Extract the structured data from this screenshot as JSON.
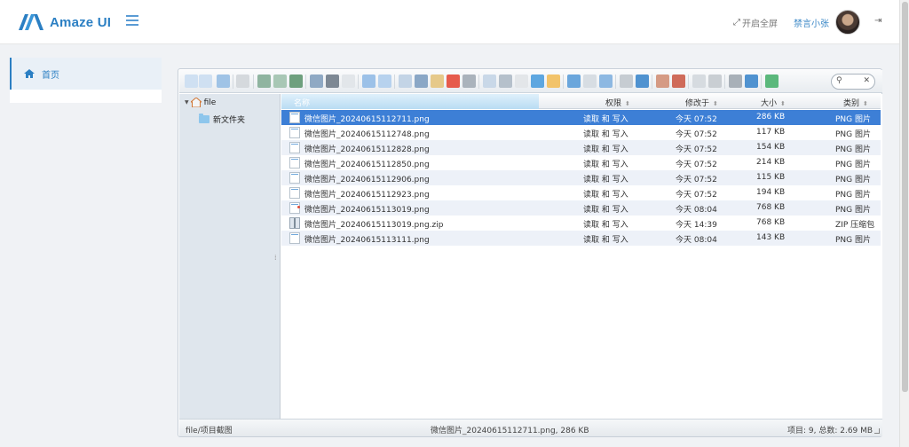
{
  "header": {
    "brand": "Amaze UI",
    "fullscreen_label": "开启全屏",
    "user_name": "禁言小张"
  },
  "sidebar": {
    "items": [
      {
        "label": "首页",
        "icon": "home-icon",
        "active": true
      }
    ]
  },
  "toolbar": {
    "search_placeholder": ""
  },
  "tree": {
    "root": "file",
    "children": [
      "新文件夹"
    ]
  },
  "columns": {
    "name": "名称",
    "perm": "权限",
    "modified": "修改于",
    "size": "大小",
    "kind": "类别"
  },
  "files": [
    {
      "name": "微信图片_20240615112711.png",
      "perm": "读取 和 写入",
      "modified": "今天 07:52",
      "size": "286 KB",
      "kind": "PNG 图片",
      "selected": true
    },
    {
      "name": "微信图片_20240615112748.png",
      "perm": "读取 和 写入",
      "modified": "今天 07:52",
      "size": "117 KB",
      "kind": "PNG 图片"
    },
    {
      "name": "微信图片_20240615112828.png",
      "perm": "读取 和 写入",
      "modified": "今天 07:52",
      "size": "154 KB",
      "kind": "PNG 图片"
    },
    {
      "name": "微信图片_20240615112850.png",
      "perm": "读取 和 写入",
      "modified": "今天 07:52",
      "size": "214 KB",
      "kind": "PNG 图片"
    },
    {
      "name": "微信图片_20240615112906.png",
      "perm": "读取 和 写入",
      "modified": "今天 07:52",
      "size": "115 KB",
      "kind": "PNG 图片"
    },
    {
      "name": "微信图片_20240615112923.png",
      "perm": "读取 和 写入",
      "modified": "今天 07:52",
      "size": "194 KB",
      "kind": "PNG 图片"
    },
    {
      "name": "微信图片_20240615113019.png",
      "perm": "读取 和 写入",
      "modified": "今天 08:04",
      "size": "768 KB",
      "kind": "PNG 图片"
    },
    {
      "name": "微信图片_20240615113019.png.zip",
      "perm": "读取 和 写入",
      "modified": "今天 14:39",
      "size": "768 KB",
      "kind": "ZIP 压缩包"
    },
    {
      "name": "微信图片_20240615113111.png",
      "perm": "读取 和 写入",
      "modified": "今天 08:04",
      "size": "143 KB",
      "kind": "PNG 图片"
    }
  ],
  "status": {
    "path": "file/项目截图",
    "selection": "微信图片_20240615112711.png, 286 KB",
    "summary": "项目: 9, 总数: 2.69 MB"
  },
  "colors": {
    "accent": "#2b7fc3",
    "selection": "#3d7fd6",
    "row_alt": "#edf1f8"
  }
}
